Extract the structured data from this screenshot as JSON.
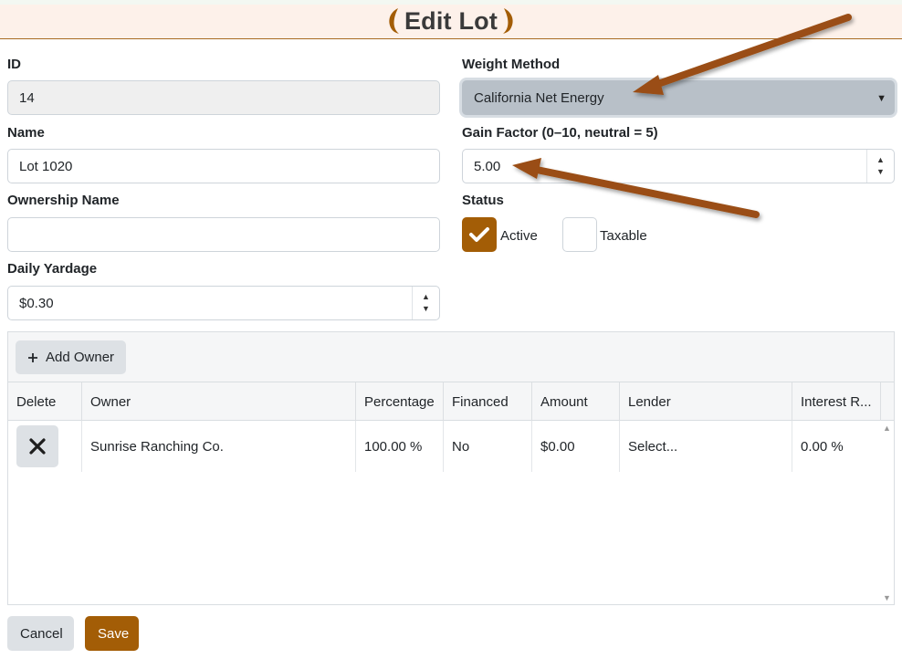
{
  "header": {
    "title": "Edit Lot"
  },
  "form": {
    "id": {
      "label": "ID",
      "value": "14"
    },
    "name": {
      "label": "Name",
      "value": "Lot 1020"
    },
    "ownership_name": {
      "label": "Ownership Name",
      "value": ""
    },
    "daily_yardage": {
      "label": "Daily Yardage",
      "value": "$0.30"
    },
    "weight_method": {
      "label": "Weight Method",
      "value": "California Net Energy"
    },
    "gain_factor": {
      "label": "Gain Factor (0–10, neutral = 5)",
      "value": "5.00"
    },
    "status": {
      "label": "Status",
      "active": {
        "label": "Active",
        "checked": true
      },
      "taxable": {
        "label": "Taxable",
        "checked": false
      }
    }
  },
  "owners_grid": {
    "add_label": "Add Owner",
    "columns": [
      "Delete",
      "Owner",
      "Percentage",
      "Financed",
      "Amount",
      "Lender",
      "Interest R..."
    ],
    "rows": [
      {
        "owner": "Sunrise Ranching Co.",
        "percentage": "100.00 %",
        "financed": "No",
        "amount": "$0.00",
        "lender": "Select...",
        "interest": "0.00 %"
      }
    ]
  },
  "actions": {
    "cancel_label": "Cancel",
    "save_label": "Save"
  },
  "colors": {
    "accent": "#a35d06",
    "arrow": "#9a4e12",
    "select_bg": "#b8c0c8"
  }
}
